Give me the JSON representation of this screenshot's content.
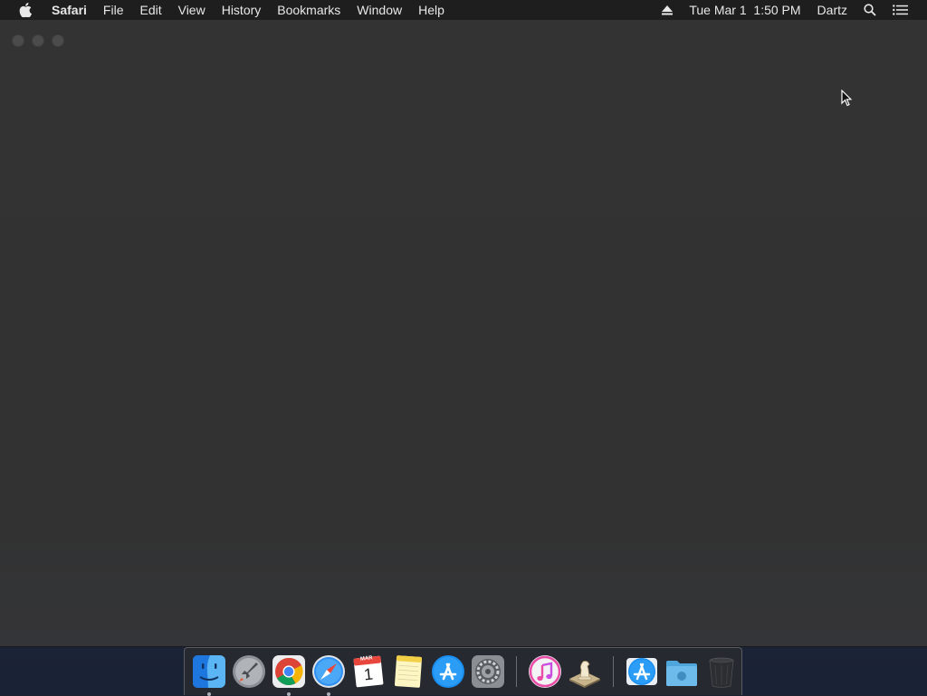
{
  "menubar": {
    "apple_icon": "apple-icon",
    "app_name": "Safari",
    "items": [
      "File",
      "Edit",
      "View",
      "History",
      "Bookmarks",
      "Window",
      "Help"
    ],
    "status": {
      "eject_icon": "eject-icon",
      "datetime": "Tue Mar 1  1:50 PM",
      "user": "Dartz",
      "search_icon": "spotlight-search-icon",
      "notification_icon": "notification-center-icon"
    }
  },
  "window": {
    "traffic_lights": [
      "close",
      "minimize",
      "zoom"
    ]
  },
  "dock": {
    "apps": [
      {
        "name": "Finder",
        "icon": "finder-icon",
        "running": true
      },
      {
        "name": "Launchpad",
        "icon": "launchpad-icon",
        "running": false
      },
      {
        "name": "Google Chrome",
        "icon": "chrome-icon",
        "running": true
      },
      {
        "name": "Safari",
        "icon": "safari-icon",
        "running": true
      },
      {
        "name": "Calendar",
        "icon": "calendar-icon",
        "running": false,
        "month": "MAR",
        "day": "1"
      },
      {
        "name": "Notes",
        "icon": "notes-icon",
        "running": false
      },
      {
        "name": "App Store",
        "icon": "app-store-icon",
        "running": false
      },
      {
        "name": "System Preferences",
        "icon": "system-preferences-icon",
        "running": false
      },
      {
        "name": "iTunes",
        "icon": "itunes-icon",
        "running": false
      },
      {
        "name": "Chess",
        "icon": "chess-icon",
        "running": false
      }
    ],
    "others": [
      {
        "name": "Applications",
        "icon": "app-store-folder-icon"
      },
      {
        "name": "Downloads",
        "icon": "downloads-folder-icon"
      },
      {
        "name": "Trash",
        "icon": "trash-icon"
      }
    ]
  },
  "colors": {
    "menubar_bg": "#1e1e1e",
    "window_bg": "#333333",
    "desktop_bg": "#1f2635"
  }
}
